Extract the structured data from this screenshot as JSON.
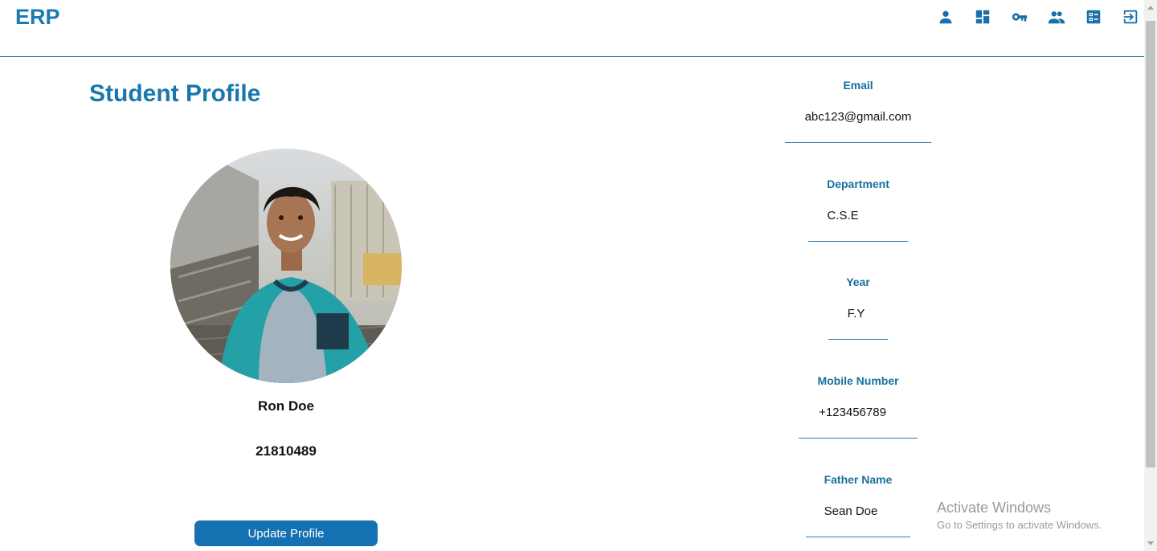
{
  "header": {
    "logo": "ERP",
    "nav_icons": [
      "person-icon",
      "dashboard-icon",
      "key-icon",
      "people-icon",
      "checklist-icon",
      "logout-icon"
    ]
  },
  "profile": {
    "title": "Student Profile",
    "name": "Ron Doe",
    "id": "21810489",
    "update_button": "Update Profile"
  },
  "fields": [
    {
      "label": "Email",
      "value": "abc123@gmail.com"
    },
    {
      "label": "Department",
      "value": "C.S.E"
    },
    {
      "label": "Year",
      "value": "F.Y"
    },
    {
      "label": "Mobile Number",
      "value": "+123456789"
    },
    {
      "label": "Father Name",
      "value": "Sean Doe"
    }
  ],
  "watermark": {
    "line1": "Activate Windows",
    "line2": "Go to Settings to activate Windows."
  },
  "colors": {
    "accent": "#1a77ad",
    "button": "#1671b2",
    "label": "#176f9e"
  }
}
